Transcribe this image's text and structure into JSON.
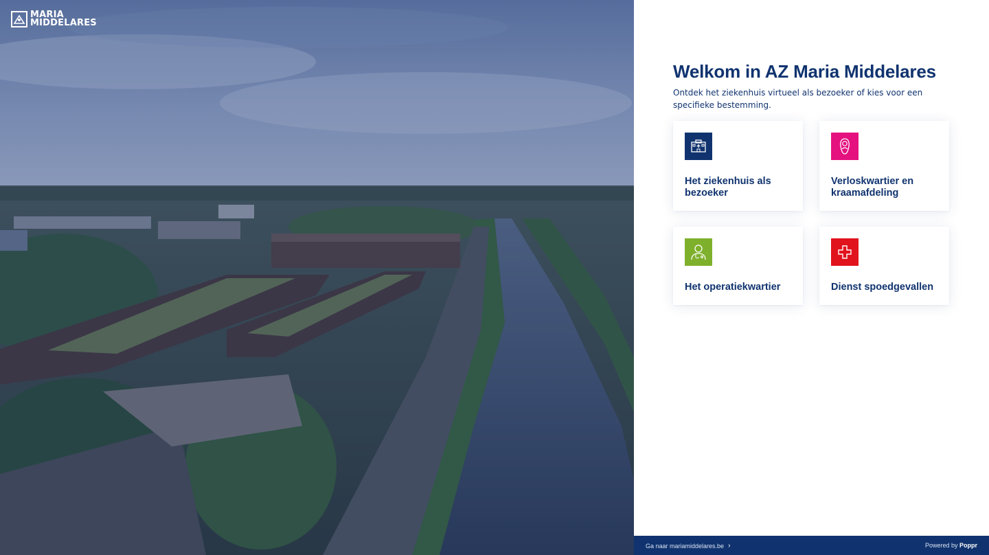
{
  "brand": {
    "logo_line1": "MARIA",
    "logo_line2": "MIDDELARES"
  },
  "welcome": {
    "title": "Welkom in AZ Maria Middelares",
    "subtitle": "Ontdek het ziekenhuis virtueel als bezoeker of kies voor een specifieke bestemming."
  },
  "destinations": [
    {
      "label": "Het ziekenhuis als bezoeker",
      "icon": "hospital-icon",
      "color": "#10336f"
    },
    {
      "label": "Verloskwartier en kraamafdeling",
      "icon": "baby-icon",
      "color": "#e4117f"
    },
    {
      "label": "Het operatiekwartier",
      "icon": "doctor-icon",
      "color": "#7fb02c"
    },
    {
      "label": "Dienst spoedgevallen",
      "icon": "red-cross-icon",
      "color": "#e1131d"
    }
  ],
  "footer": {
    "site_link": "Ga naar mariamiddelares.be",
    "powered_prefix": "Powered by",
    "powered_brand": "Poppr"
  },
  "colors": {
    "primary": "#10336f",
    "text": "#10336f",
    "footer_bg": "#10336f"
  }
}
